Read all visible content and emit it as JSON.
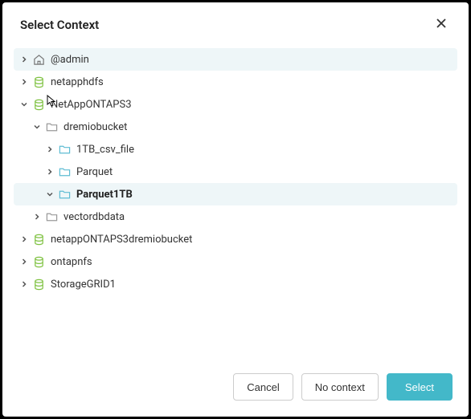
{
  "dialog": {
    "title": "Select Context"
  },
  "tree": [
    {
      "label": "@admin",
      "indent": 0,
      "icon": "home",
      "expanded": false,
      "highlight": true,
      "bold": false
    },
    {
      "label": "netapphdfs",
      "indent": 0,
      "icon": "database",
      "expanded": false,
      "highlight": false,
      "bold": false
    },
    {
      "label": "NetAppONTAPS3",
      "indent": 0,
      "icon": "database",
      "expanded": true,
      "highlight": false,
      "bold": false
    },
    {
      "label": "dremiobucket",
      "indent": 1,
      "icon": "folder",
      "expanded": true,
      "highlight": false,
      "bold": false
    },
    {
      "label": "1TB_csv_file",
      "indent": 2,
      "icon": "folder-blue",
      "expanded": false,
      "highlight": false,
      "bold": false
    },
    {
      "label": "Parquet",
      "indent": 2,
      "icon": "folder-blue",
      "expanded": false,
      "highlight": false,
      "bold": false
    },
    {
      "label": "Parquet1TB",
      "indent": 2,
      "icon": "folder-blue",
      "expanded": true,
      "highlight": true,
      "bold": true
    },
    {
      "label": "vectordbdata",
      "indent": 1,
      "icon": "folder",
      "expanded": false,
      "highlight": false,
      "bold": false
    },
    {
      "label": "netappONTAPS3dremiobucket",
      "indent": 0,
      "icon": "database",
      "expanded": false,
      "highlight": false,
      "bold": false
    },
    {
      "label": "ontapnfs",
      "indent": 0,
      "icon": "database",
      "expanded": false,
      "highlight": false,
      "bold": false
    },
    {
      "label": "StorageGRID1",
      "indent": 0,
      "icon": "database",
      "expanded": false,
      "highlight": false,
      "bold": false
    }
  ],
  "footer": {
    "cancel": "Cancel",
    "nocontext": "No context",
    "select": "Select"
  }
}
